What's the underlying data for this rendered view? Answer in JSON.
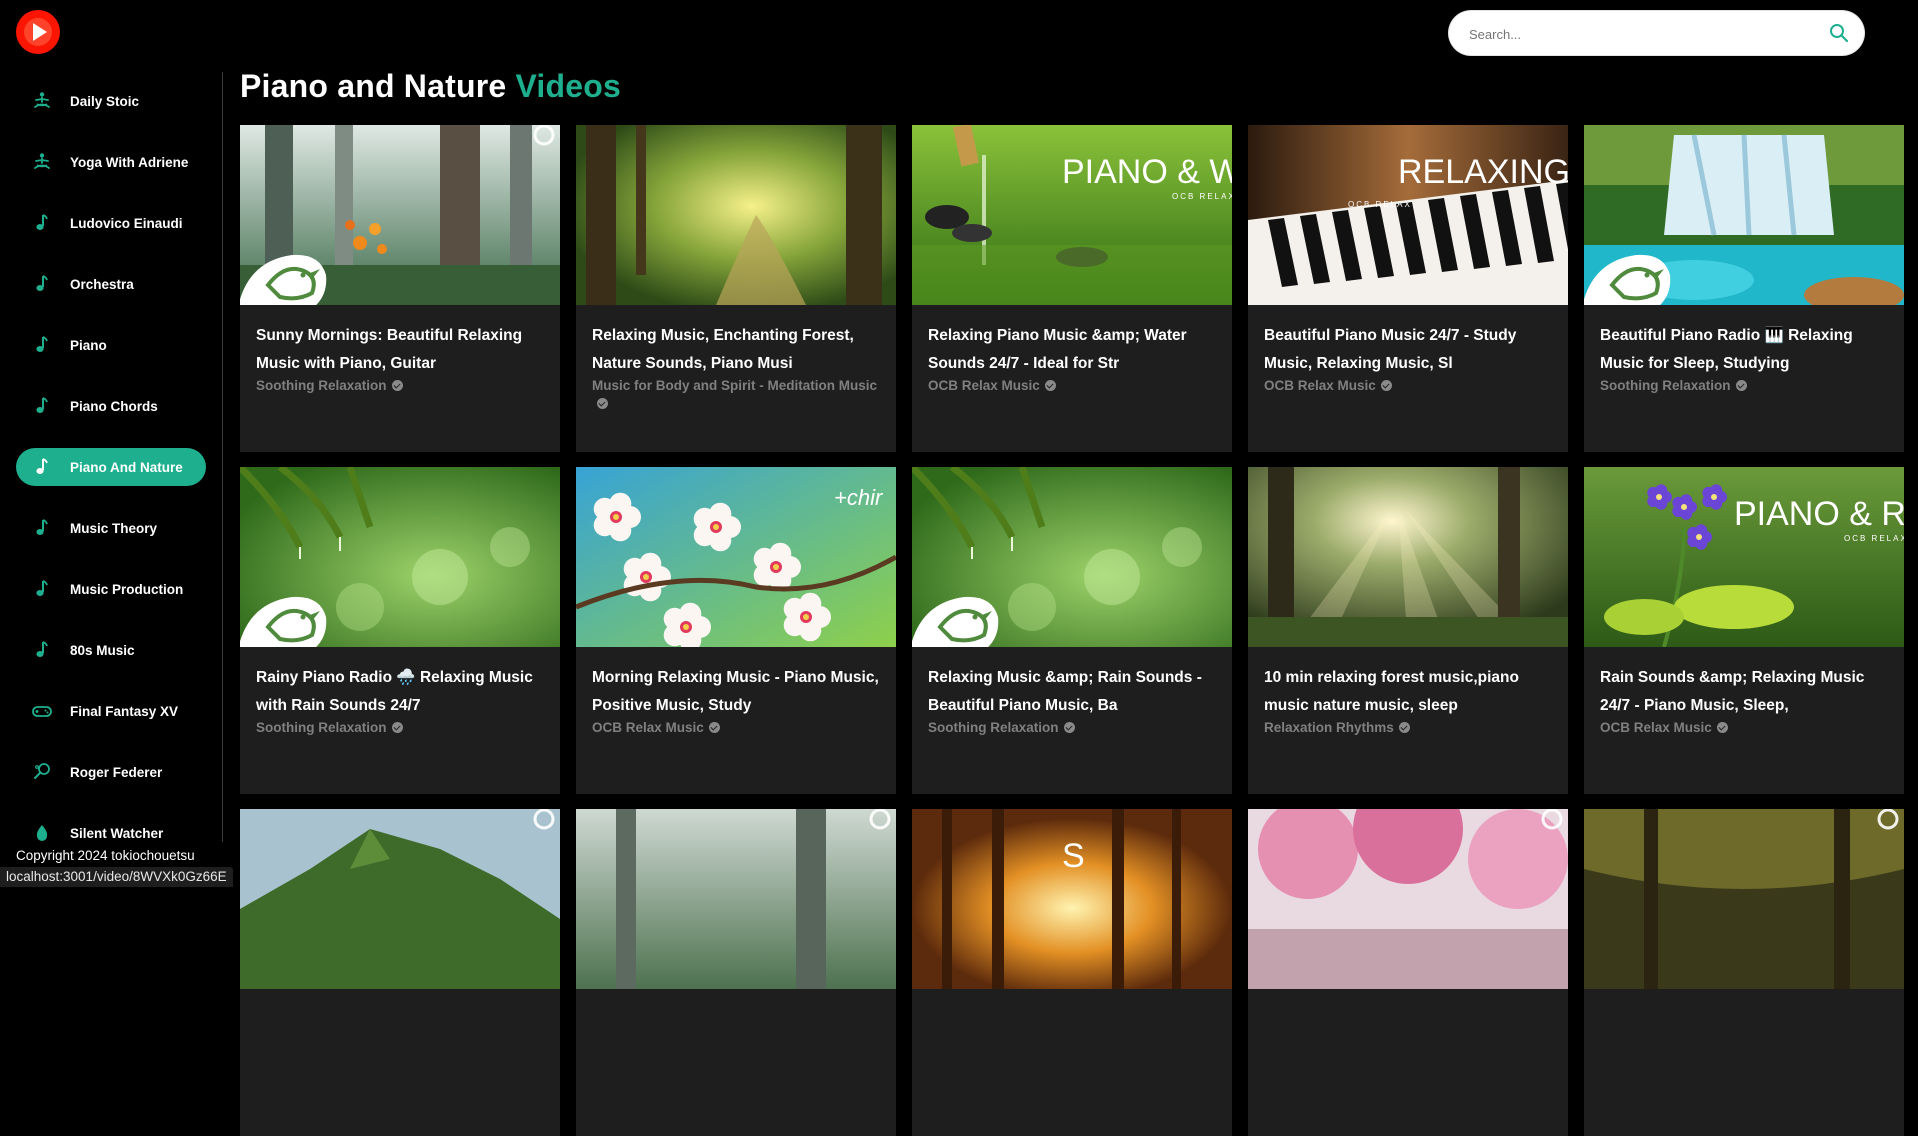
{
  "app": {
    "logo": "youtube-play-logo",
    "accent": "#1eaf8e",
    "brand": "#fc1503"
  },
  "search": {
    "placeholder": "Search...",
    "icon": "search-icon"
  },
  "sidebar": {
    "items": [
      {
        "label": "Daily Stoic",
        "icon": "meditation-icon"
      },
      {
        "label": "Yoga With Adriene",
        "icon": "meditation-icon"
      },
      {
        "label": "Ludovico Einaudi",
        "icon": "music-note-icon"
      },
      {
        "label": "Orchestra",
        "icon": "music-note-icon"
      },
      {
        "label": "Piano",
        "icon": "music-note-icon"
      },
      {
        "label": "Piano Chords",
        "icon": "music-note-icon"
      },
      {
        "label": "Piano And Nature",
        "icon": "music-note-icon",
        "selected": true
      },
      {
        "label": "Music Theory",
        "icon": "music-note-icon"
      },
      {
        "label": "Music Production",
        "icon": "music-note-icon"
      },
      {
        "label": "80s Music",
        "icon": "music-note-icon"
      },
      {
        "label": "Final Fantasy XV",
        "icon": "gamepad-icon"
      },
      {
        "label": "Roger Federer",
        "icon": "tennis-racket-icon"
      },
      {
        "label": "Silent Watcher",
        "icon": "water-drop-icon"
      }
    ],
    "copyright": "Copyright 2024 tokiochouetsu"
  },
  "heading": {
    "part1": "Piano and Nature",
    "part2": "Videos"
  },
  "videos": [
    {
      "title": "Sunny Mornings: Beautiful Relaxing Music with Piano, Guitar",
      "channel": "Soothing Relaxation",
      "thumb": "misty-forest-flowers"
    },
    {
      "title": "Relaxing Music, Enchanting Forest, Nature Sounds, Piano Musi",
      "channel": "Music for Body and Spirit - Meditation Music",
      "thumb": "sunlit-forest-path"
    },
    {
      "title": "Relaxing Piano Music &amp; Water Sounds 24/7 - Ideal for Str",
      "channel": "OCB Relax Music",
      "thumb": "bamboo-water-stones",
      "overlay": "PIANO & WATE",
      "overlay_sub": "OCB RELAX"
    },
    {
      "title": "Beautiful Piano Music 24/7 - Study Music, Relaxing Music, Sl",
      "channel": "OCB Relax Music",
      "thumb": "piano-keys",
      "overlay": "RELAXING PIANO",
      "overlay_sub": "OCB RELAX"
    },
    {
      "title": "Beautiful Piano Radio 🎹 Relaxing Music for Sleep, Studying",
      "channel": "Soothing Relaxation",
      "thumb": "waterfall-pool"
    },
    {
      "title": "Rainy Piano Radio 🌧️ Relaxing Music with Rain Sounds 24/7",
      "channel": "Soothing Relaxation",
      "thumb": "rain-leaves"
    },
    {
      "title": "Morning Relaxing Music - Piano Music, Positive Music, Study",
      "channel": "OCB Relax Music",
      "thumb": "cherry-blossoms",
      "overlay": "+chir"
    },
    {
      "title": "Relaxing Music &amp; Rain Sounds - Beautiful Piano Music, Ba",
      "channel": "Soothing Relaxation",
      "thumb": "rain-leaves"
    },
    {
      "title": "10 min relaxing forest music,piano music nature music, sleep",
      "channel": "Relaxation Rhythms",
      "thumb": "sunbeam-forest"
    },
    {
      "title": "Rain Sounds &amp; Relaxing Music 24/7 - Piano Music, Sleep,",
      "channel": "OCB Relax Music",
      "thumb": "purple-flowers-rain",
      "overlay": "PIANO & RAI",
      "overlay_sub": "OCB RELAX"
    },
    {
      "title": "",
      "channel": "",
      "thumb": "green-hill-lake"
    },
    {
      "title": "",
      "channel": "",
      "thumb": "misty-forest"
    },
    {
      "title": "",
      "channel": "",
      "thumb": "autumn-sunset-forest",
      "overlay": "S"
    },
    {
      "title": "",
      "channel": "",
      "thumb": "pink-cherry-trees"
    },
    {
      "title": "",
      "channel": "",
      "thumb": "stream-forest"
    }
  ],
  "status_url": "localhost:3001/video/8WVXk0Gz66E"
}
